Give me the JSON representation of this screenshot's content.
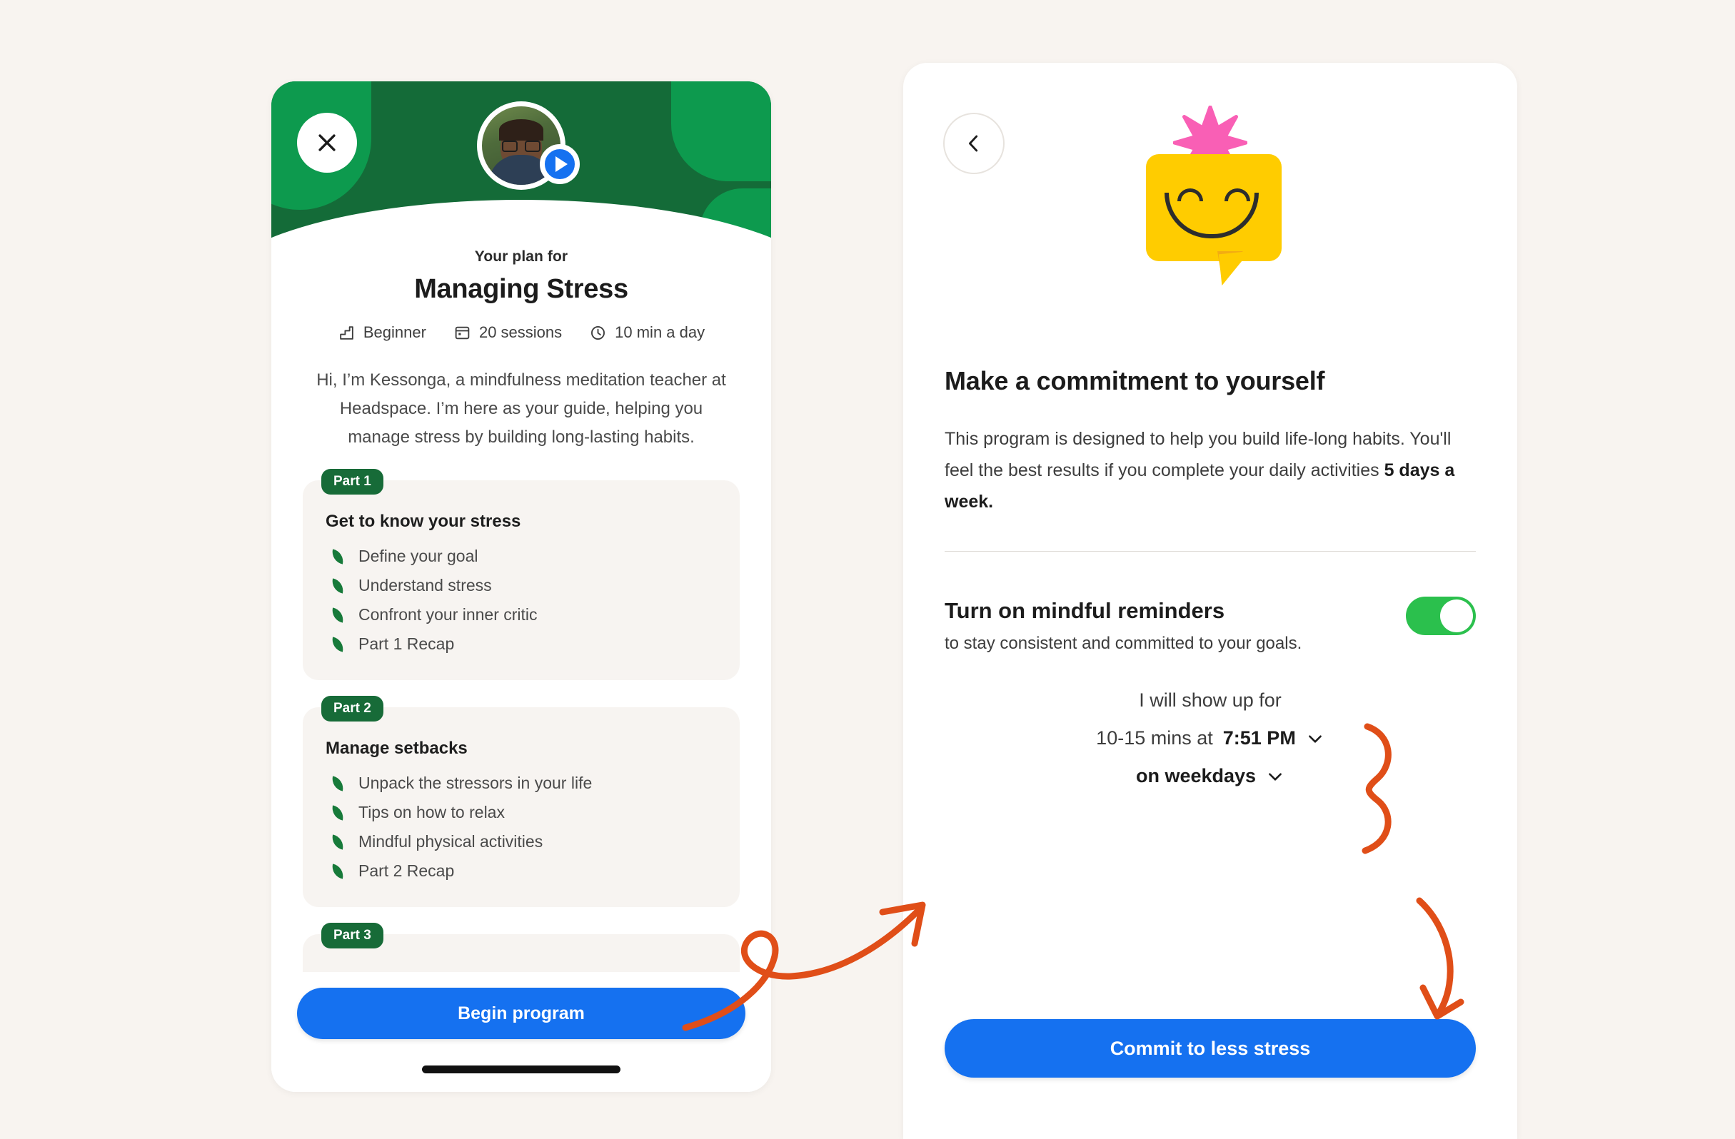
{
  "page": {
    "background_color": "#F8F4F0",
    "accent_blue": "#1571F0",
    "brand_green": "#146B38",
    "toggle_green": "#2BC04D",
    "annotation_orange": "#E04E18"
  },
  "left_screen": {
    "close_icon": "close-icon",
    "play_icon": "play-icon",
    "avatar": "teacher-avatar",
    "eyebrow": "Your plan for",
    "title": "Managing Stress",
    "meta": [
      {
        "icon": "level-stairs-icon",
        "label": "Beginner"
      },
      {
        "icon": "sessions-calendar-icon",
        "label": "20 sessions"
      },
      {
        "icon": "clock-icon",
        "label": "10 min a day"
      }
    ],
    "intro": "Hi, I’m Kessonga, a mindfulness meditation teacher at Headspace. I’m here as your guide, helping you manage stress by building long-lasting habits.",
    "parts": [
      {
        "badge": "Part 1",
        "heading": "Get to know your stress",
        "lessons": [
          "Define your goal",
          "Understand stress",
          "Confront your inner critic",
          "Part 1 Recap"
        ]
      },
      {
        "badge": "Part 2",
        "heading": "Manage setbacks",
        "lessons": [
          "Unpack the stressors in your life",
          "Tips on how to relax",
          "Mindful physical activities",
          "Part 2 Recap"
        ]
      },
      {
        "badge": "Part 3",
        "heading": "",
        "lessons": []
      }
    ],
    "begin_button": "Begin program"
  },
  "right_screen": {
    "back_icon": "chevron-left-icon",
    "illustration": "yellow-speech-bubble-smiling-face-with-pink-star",
    "heading": "Make a commitment to yourself",
    "body_prefix": "This program is designed to help you build life-long habits. You'll feel the best results if you complete your daily activities ",
    "body_highlight": "5 days a week.",
    "reminders_title": "Turn on mindful reminders",
    "reminders_subtitle": "to stay consistent and committed to your goals.",
    "reminders_toggle_state": "on",
    "schedule": {
      "line1": "I will show up for",
      "duration": "10-15 mins at",
      "time": "7:51 PM",
      "time_chevron": "chevron-down-icon",
      "days": "on weekdays",
      "days_chevron": "chevron-down-icon"
    },
    "commit_button": "Commit to less stress"
  },
  "annotations": {
    "arrow_to_right_screen": "curved-looping-arrow",
    "arrow_to_commit_button": "curved-down-arrow",
    "brace": "curly-brace-highlight"
  }
}
